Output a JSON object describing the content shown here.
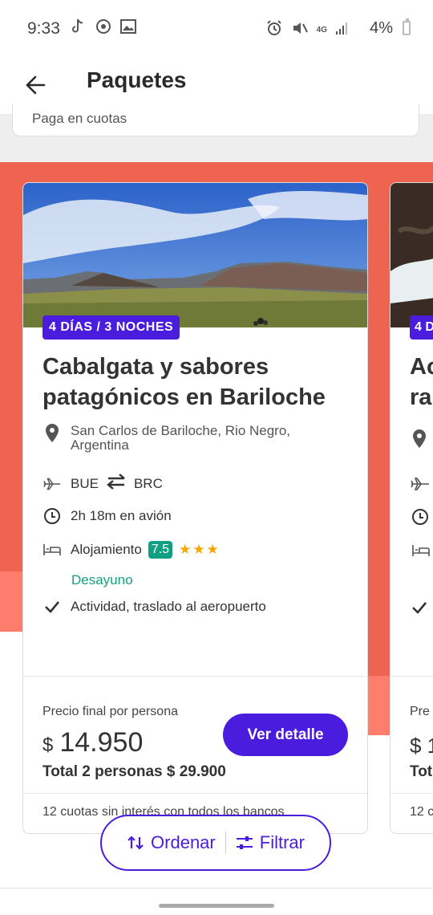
{
  "status_bar": {
    "time": "9:33",
    "battery": "4%",
    "network": "4G"
  },
  "app_bar": {
    "title": "Paquetes"
  },
  "search": {
    "value": "Paga en cuotas"
  },
  "card": {
    "badge": "4 DÍAS / 3 NOCHES",
    "title": "Cabalgata y sabores patagónicos en Bariloche",
    "location": "San Carlos de Bariloche, Rio Negro, Argentina",
    "origin": "BUE",
    "destination": "BRC",
    "flight_time": "2h 18m en avión",
    "lodging_label": "Alojamiento",
    "lodging_score": "7.5",
    "lodging_stars": "★★★",
    "meal": "Desayuno",
    "activity": "Actividad, traslado al aeropuerto",
    "price_label": "Precio final por persona",
    "currency": "$",
    "price": "14.950",
    "total": "Total 2 personas $ 29.900",
    "cta": "Ver detalle",
    "installments": "12 cuotas sin interés con todos los bancos"
  },
  "card2": {
    "badge": "4 D",
    "title_line1": "Ac",
    "title_line2": "ra",
    "price_label": "Pre",
    "price": "$ 1",
    "total": "Tot",
    "installments": "12 c"
  },
  "fab": {
    "sort_label": "Ordenar",
    "filter_label": "Filtrar"
  },
  "colors": {
    "accent": "#4a1cdd",
    "banner": "#ee6450",
    "score": "#12a083",
    "meal": "#14a07d"
  }
}
